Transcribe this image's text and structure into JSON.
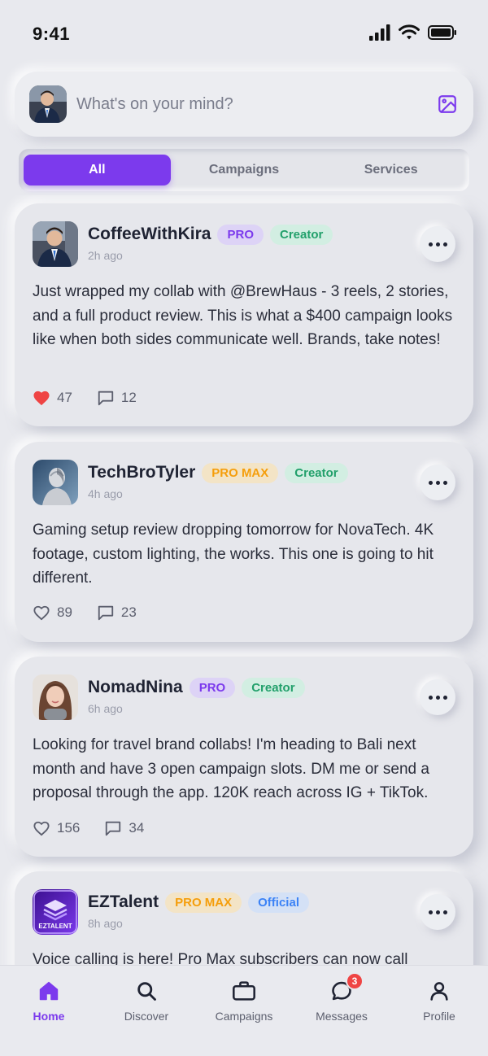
{
  "status_bar": {
    "time": "9:41"
  },
  "composer": {
    "placeholder": "What's on your mind?"
  },
  "tabs": [
    {
      "label": "All",
      "active": true
    },
    {
      "label": "Campaigns",
      "active": false
    },
    {
      "label": "Services",
      "active": false
    }
  ],
  "posts": [
    {
      "username": "CoffeeWithKira",
      "badges": [
        "PRO",
        "Creator"
      ],
      "time": "2h ago",
      "text": "Just wrapped my collab with @BrewHaus - 3 reels, 2 stories, and a full product review. This is what a $400 campaign looks like when both sides communicate well. Brands, take notes!",
      "likes": "47",
      "liked": true,
      "comments": "12"
    },
    {
      "username": "TechBroTyler",
      "badges": [
        "PRO MAX",
        "Creator"
      ],
      "time": "4h ago",
      "text": "Gaming setup review dropping tomorrow for NovaTech. 4K footage, custom lighting, the works. This one is going to hit different.",
      "likes": "89",
      "liked": false,
      "comments": "23"
    },
    {
      "username": "NomadNina",
      "badges": [
        "PRO",
        "Creator"
      ],
      "time": "6h ago",
      "text": "Looking for travel brand collabs! I'm heading to Bali next month and have 3 open campaign slots. DM me or send a proposal through the app. 120K reach across IG + TikTok.",
      "likes": "156",
      "liked": false,
      "comments": "34"
    },
    {
      "username": "EZTalent",
      "badges": [
        "PRO MAX",
        "Official"
      ],
      "time": "8h ago",
      "text": "Voice calling is here! Pro Max subscribers can now call",
      "logo_text": "EZTALENT"
    }
  ],
  "bottom_nav": [
    {
      "label": "Home",
      "icon": "home-icon",
      "active": true
    },
    {
      "label": "Discover",
      "icon": "search-icon",
      "active": false
    },
    {
      "label": "Campaigns",
      "icon": "briefcase-icon",
      "active": false
    },
    {
      "label": "Messages",
      "icon": "chat-icon",
      "active": false,
      "badge": "3"
    },
    {
      "label": "Profile",
      "icon": "user-icon",
      "active": false
    }
  ],
  "colors": {
    "accent": "#7c3aed",
    "like": "#ef4444",
    "pro_max": "#f59e0b",
    "creator": "#22a06b",
    "official": "#3b82f6"
  }
}
